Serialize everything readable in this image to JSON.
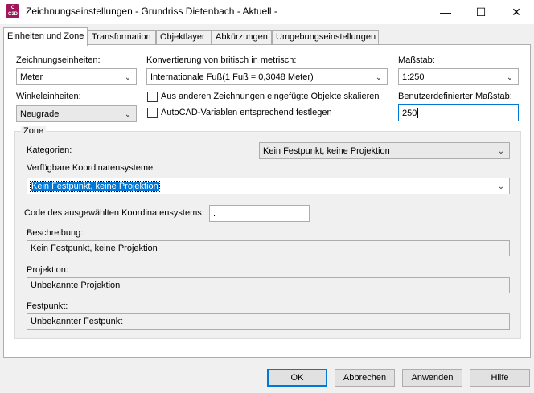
{
  "window": {
    "title": "Zeichnungseinstellungen - Grundriss Dietenbach - Aktuell -",
    "app_icon_text": "C\nC3D",
    "close_glyph": "✕",
    "maximize_glyph": "☐",
    "minimize_glyph": "—"
  },
  "tabs": [
    {
      "label": "Einheiten und Zone"
    },
    {
      "label": "Transformation"
    },
    {
      "label": "Objektlayer"
    },
    {
      "label": "Abkürzungen"
    },
    {
      "label": "Umgebungseinstellungen"
    }
  ],
  "units": {
    "drawing_units_label": "Zeichnungseinheiten:",
    "drawing_units_value": "Meter",
    "conversion_label": "Konvertierung von britisch in metrisch:",
    "conversion_value": "Internationale Fuß(1 Fuß = 0,3048 Meter)",
    "scale_label": "Maßstab:",
    "scale_value": "1:250",
    "angle_units_label": "Winkeleinheiten:",
    "angle_units_value": "Neugrade",
    "scale_objects_label": "Aus anderen Zeichnungen eingefügte Objekte skalieren",
    "scale_objects_checked": false,
    "autocad_vars_label": "AutoCAD-Variablen entsprechend festlegen",
    "autocad_vars_checked": false,
    "custom_scale_label": "Benutzerdefinierter Maßstab:",
    "custom_scale_value": "250"
  },
  "zone": {
    "title": "Zone",
    "categories_label": "Kategorien:",
    "categories_value": "Kein Festpunkt, keine Projektion",
    "available_cs_label": "Verfügbare Koordinatensysteme:",
    "available_cs_value": "Kein Festpunkt, keine Projektion",
    "code_label": "Code des ausgewählten Koordinatensystems:",
    "code_value": ".",
    "description_label": "Beschreibung:",
    "description_value": "Kein Festpunkt, keine Projektion",
    "projection_label": "Projektion:",
    "projection_value": "Unbekannte Projektion",
    "datum_label": "Festpunkt:",
    "datum_value": "Unbekannter Festpunkt"
  },
  "buttons": {
    "ok": "OK",
    "cancel": "Abbrechen",
    "apply": "Anwenden",
    "help": "Hilfe"
  },
  "colors": {
    "accent": "#0078d7",
    "app_icon": "#a0155c"
  }
}
